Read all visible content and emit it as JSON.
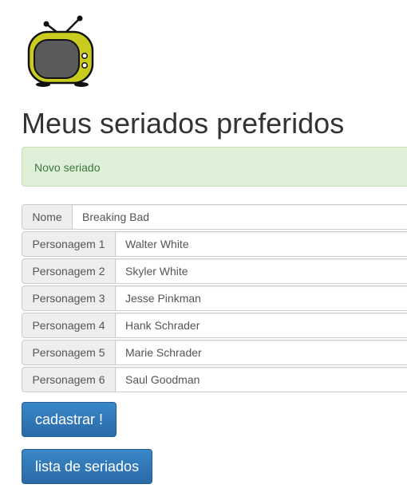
{
  "logo": {
    "icon": "tv-icon",
    "colors": {
      "body": "#c9cc1e",
      "screen": "#5a5a5a",
      "outline": "#111111"
    }
  },
  "page": {
    "title": "Meus seriados preferidos"
  },
  "alert": {
    "text": "Novo seriado",
    "color": "#3c763d",
    "background": "#dff0d8"
  },
  "form": {
    "name": {
      "label": "Nome",
      "value": "Breaking Bad"
    },
    "characters": [
      {
        "label": "Personagem 1",
        "value": "Walter White"
      },
      {
        "label": "Personagem 2",
        "value": "Skyler White"
      },
      {
        "label": "Personagem 3",
        "value": "Jesse Pinkman"
      },
      {
        "label": "Personagem 4",
        "value": "Hank Schrader"
      },
      {
        "label": "Personagem 5",
        "value": "Marie Schrader"
      },
      {
        "label": "Personagem 6",
        "value": "Saul Goodman"
      }
    ]
  },
  "actions": {
    "submit_label": "cadastrar !",
    "list_label": "lista de seriados",
    "button_color": "#337ab7"
  }
}
